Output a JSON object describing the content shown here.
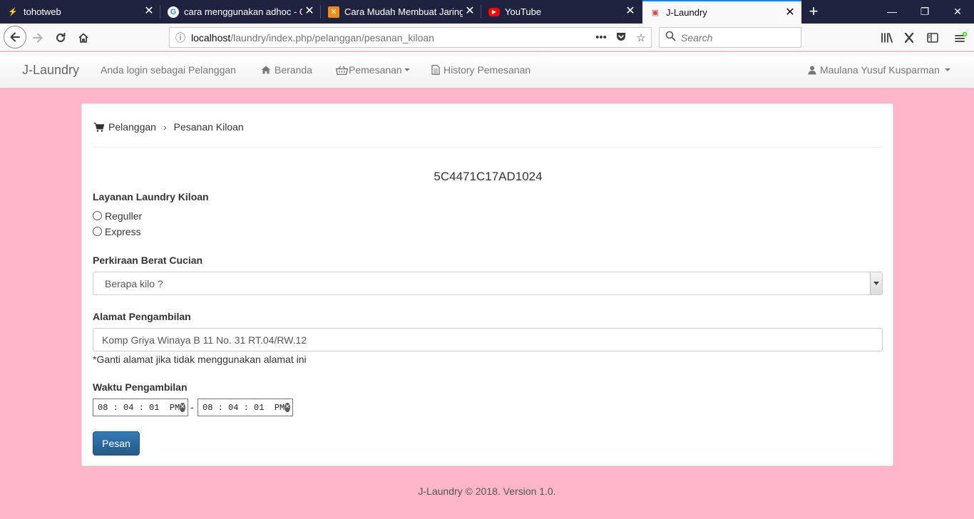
{
  "browser": {
    "tabs": [
      {
        "title": "tohotweb",
        "favicon": "⚡",
        "favicon_bg": "#202340",
        "favicon_color": "#e0c060"
      },
      {
        "title": "cara menggunakan adhoc - Go",
        "favicon": "G",
        "favicon_bg": "#ffffff",
        "favicon_color": "#4285f4"
      },
      {
        "title": "Cara Mudah Membuat Jaringan",
        "favicon": "✕",
        "favicon_bg": "#f08c1e",
        "favicon_color": "#ffffff"
      },
      {
        "title": "YouTube",
        "favicon": "▶",
        "favicon_bg": "#ff0000",
        "favicon_color": "#ffffff"
      },
      {
        "title": "J-Laundry",
        "favicon": "▣",
        "favicon_bg": "#f9f9fa",
        "favicon_color": "#c0504d",
        "active": true
      }
    ],
    "tab_close_icon": "✕",
    "new_tab_icon": "+",
    "window_controls": {
      "minimize": "—",
      "maximize": "❐",
      "close": "✕"
    },
    "url_host": "localhost",
    "url_path": "/laundry/index.php/pelanggan/pesanan_kiloan",
    "search_placeholder": "Search"
  },
  "navbar": {
    "brand": "J-Laundry",
    "login_text": "Anda login sebagai Pelanggan",
    "home_label": "Beranda",
    "order_label": "Pemesanan",
    "history_label": "History Pemesanan",
    "user_name": "Maulana Yusuf Kusparman"
  },
  "breadcrumb": {
    "parent": "Pelanggan",
    "separator": "›",
    "current": "Pesanan Kiloan"
  },
  "order_id": "5C4471C17AD1024",
  "service": {
    "label": "Layanan Laundry Kiloan",
    "options": [
      "Reguller",
      "Express"
    ]
  },
  "weight": {
    "label": "Perkiraan Berat Cucian",
    "selected": "Berapa kilo ?"
  },
  "address": {
    "label": "Alamat Pengambilan",
    "value": "Komp Griya Winaya B 11 No. 31 RT.04/RW.12",
    "hint": "*Ganti alamat jika tidak menggunakan alamat ini"
  },
  "pickup_time": {
    "label": "Waktu Pengambilan",
    "from": "08 : 04 : 01  PM",
    "separator": "-",
    "to": "08 : 04 : 01  PM"
  },
  "submit_label": "Pesan",
  "footer": "J-Laundry © 2018. Version 1.0.",
  "colors": {
    "page_bg": "#ffb6c8",
    "primary": "#337ab7",
    "tabbar": "#202340"
  }
}
